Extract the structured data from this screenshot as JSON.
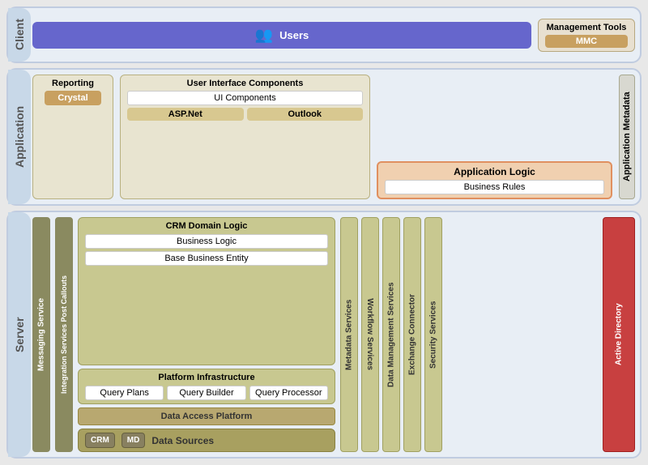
{
  "client": {
    "label": "Client",
    "users": {
      "label": "Users",
      "icon": "👥"
    },
    "management_tools": {
      "title": "Management Tools",
      "mmc": "MMC"
    }
  },
  "application": {
    "label": "Application",
    "reporting": {
      "title": "Reporting",
      "crystal": "Crystal"
    },
    "ui_components": {
      "title": "User Interface Components",
      "ui_label": "UI Components",
      "asp_net": "ASP.Net",
      "outlook": "Outlook"
    },
    "app_logic": {
      "title": "Application Logic",
      "business_rules": "Business Rules"
    },
    "metadata": "Application Metadata"
  },
  "server": {
    "label": "Server",
    "messaging": "Messaging Service",
    "integration": "Integration Services Post Callouts",
    "crm_domain": {
      "title": "CRM Domain Logic",
      "business_logic": "Business Logic",
      "base_business": "Base Business Entity"
    },
    "platform": {
      "title": "Platform Infrastructure",
      "query_plans": "Query Plans",
      "query_builder": "Query Builder",
      "query_processor": "Query Processor"
    },
    "data_access": "Data Access Platform",
    "data_sources": {
      "label": "Data Sources",
      "crm": "CRM",
      "md": "MD"
    },
    "metadata_svc": "Metadata Services",
    "workflow_svc": "Workflow Services",
    "data_mgmt": "Data Management Services",
    "exchange": "Exchange Connector",
    "security": "Security Services",
    "active_directory": "Active Directory"
  }
}
